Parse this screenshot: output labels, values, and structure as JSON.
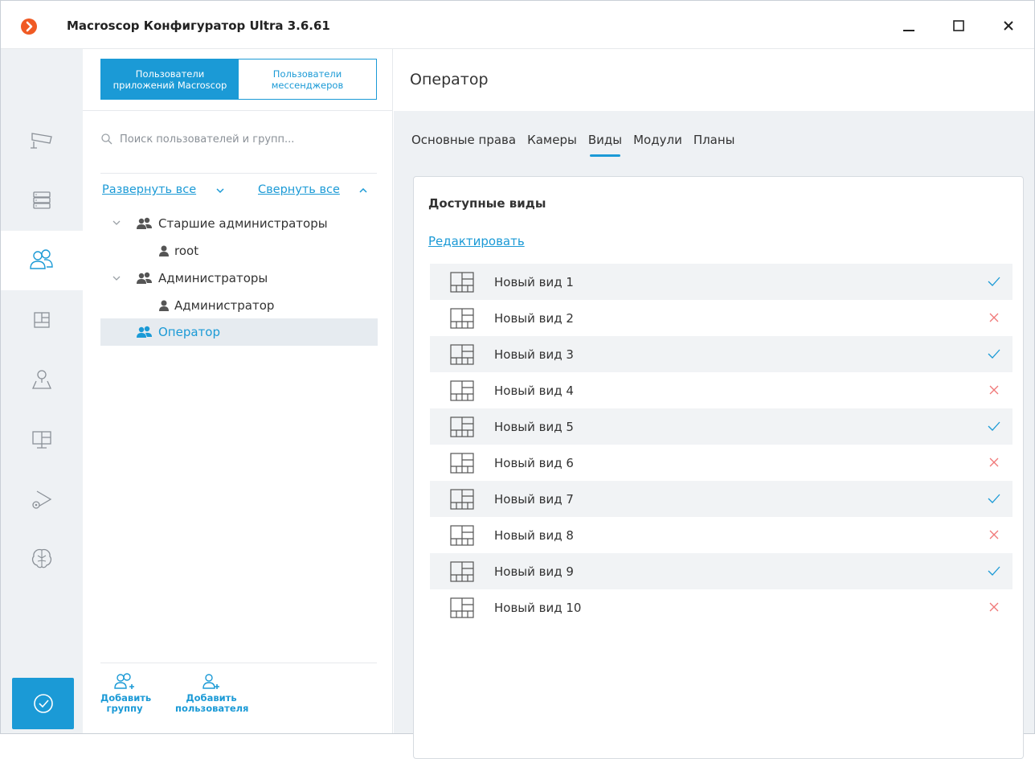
{
  "window": {
    "title": "Macroscop Конфигуратор Ultra 3.6.61"
  },
  "brand": {
    "accent": "#1b9ad6",
    "logo_color": "#f05a24",
    "ok_color": "#1b9ad6",
    "deny_color": "#f07878"
  },
  "sidebar": {
    "items": [
      {
        "icon": "camera-icon",
        "active": false
      },
      {
        "icon": "servers-icon",
        "active": false
      },
      {
        "icon": "users-icon",
        "active": true
      },
      {
        "icon": "views-icon",
        "active": false
      },
      {
        "icon": "maps-icon",
        "active": false
      },
      {
        "icon": "monitors-icon",
        "active": false
      },
      {
        "icon": "playback-settings-icon",
        "active": false
      },
      {
        "icon": "brain-icon",
        "active": false
      }
    ],
    "save": {
      "icon": "checkmark-circle-icon"
    }
  },
  "users_panel": {
    "segment": {
      "app_users": "Пользователи приложений Macroscop",
      "messenger_users": "Пользователи мессенджеров"
    },
    "search_placeholder": "Поиск пользователей и групп...",
    "expand_all": "Развернуть все",
    "collapse_all": "Свернуть все",
    "tree": [
      {
        "label": "Старшие администраторы",
        "type": "group",
        "level": 0,
        "expanded": true,
        "selected": false
      },
      {
        "label": "root",
        "type": "user",
        "level": 1,
        "expanded": false,
        "selected": false
      },
      {
        "label": "Администраторы",
        "type": "group",
        "level": 0,
        "expanded": true,
        "selected": false
      },
      {
        "label": "Администратор",
        "type": "user",
        "level": 1,
        "expanded": false,
        "selected": false
      },
      {
        "label": "Оператор",
        "type": "group",
        "level": 0,
        "expanded": false,
        "selected": true
      }
    ],
    "add_group": "Добавить группу",
    "add_user": "Добавить пользователя"
  },
  "detail": {
    "title": "Оператор",
    "tabs": [
      "Основные права",
      "Камеры",
      "Виды",
      "Модули",
      "Планы"
    ],
    "active_tab": "Виды",
    "section_title": "Доступные виды",
    "edit_link": "Редактировать",
    "views": [
      {
        "name": "Новый вид 1",
        "allowed": true
      },
      {
        "name": "Новый вид 2",
        "allowed": false
      },
      {
        "name": "Новый вид 3",
        "allowed": true
      },
      {
        "name": "Новый вид 4",
        "allowed": false
      },
      {
        "name": "Новый вид 5",
        "allowed": true
      },
      {
        "name": "Новый вид 6",
        "allowed": false
      },
      {
        "name": "Новый вид 7",
        "allowed": true
      },
      {
        "name": "Новый вид 8",
        "allowed": false
      },
      {
        "name": "Новый вид 9",
        "allowed": true
      },
      {
        "name": "Новый вид 10",
        "allowed": false
      }
    ]
  }
}
